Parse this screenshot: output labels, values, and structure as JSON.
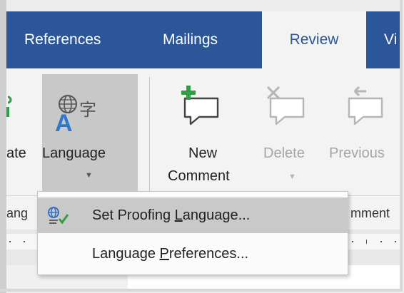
{
  "tabs": [
    {
      "label": "References"
    },
    {
      "label": "Mailings"
    },
    {
      "label": "Review"
    },
    {
      "label": "Vi"
    }
  ],
  "ribbon": {
    "translate_partial": "ate",
    "language_label": "Language",
    "new_label_1": "New",
    "new_label_2": "Comment",
    "delete_label": "Delete",
    "previous_label": "Previous"
  },
  "group_labels": {
    "language_partial": "ang",
    "comments_partial": "mment"
  },
  "menu": {
    "items": [
      {
        "label_before": "Set Proofing ",
        "accel": "L",
        "label_after": "anguage..."
      },
      {
        "label_before": "Language ",
        "accel": "P",
        "label_after": "references..."
      }
    ]
  },
  "colors": {
    "tab_bar": "#2b579a",
    "ribbon": "#f3f3f3",
    "accent_green": "#2e9e47"
  }
}
